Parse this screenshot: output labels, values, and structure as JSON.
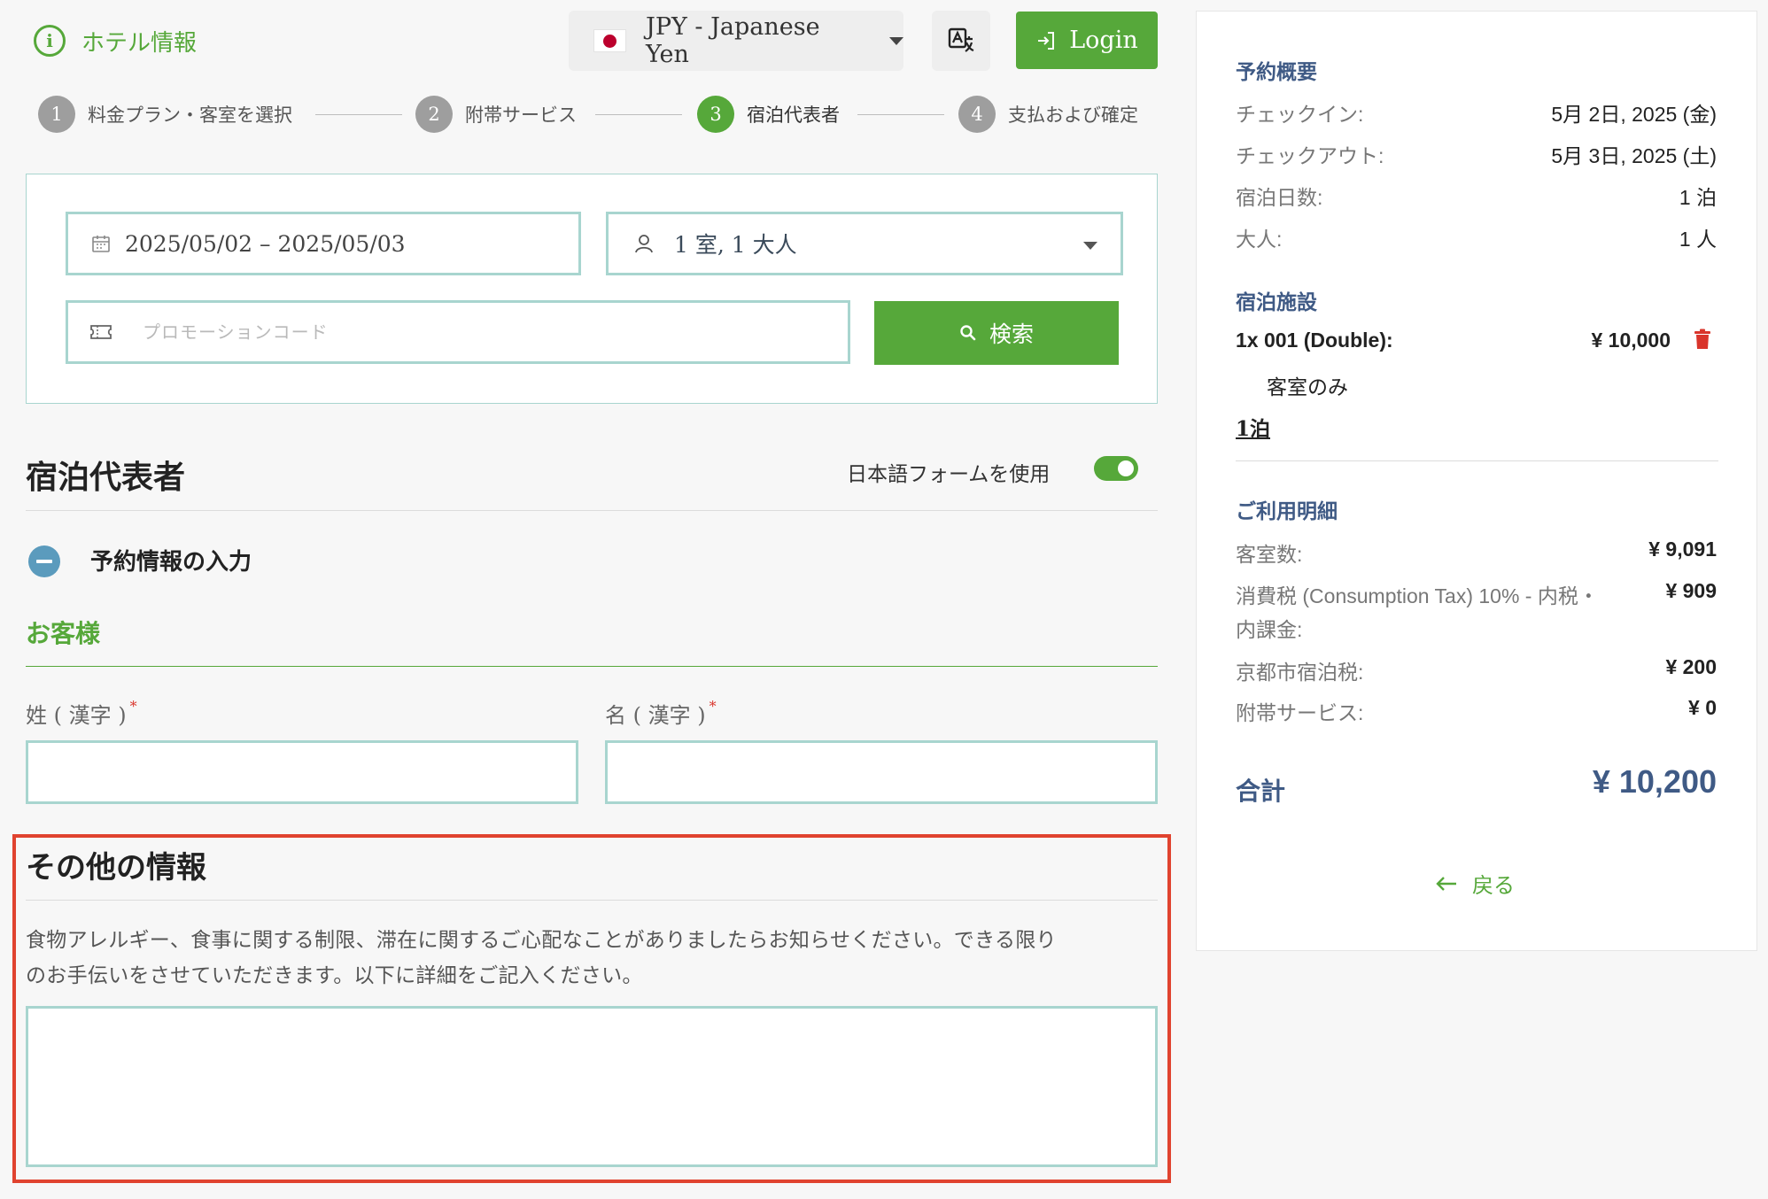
{
  "header": {
    "hotel_info_label": "ホテル情報",
    "currency_label": "JPY - Japanese Yen",
    "login_label": "Login"
  },
  "steps": [
    {
      "num": "1",
      "label": "料金プラン・客室を選択",
      "state": "done"
    },
    {
      "num": "2",
      "label": "附帯サービス",
      "state": "done"
    },
    {
      "num": "3",
      "label": "宿泊代表者",
      "state": "active"
    },
    {
      "num": "4",
      "label": "支払および確定",
      "state": "todo"
    }
  ],
  "search": {
    "date_range": "2025/05/02 – 2025/05/03",
    "guests": "1 室, 1 大人",
    "promo_placeholder": "プロモーションコード",
    "search_label": "検索"
  },
  "guest_section": {
    "title": "宿泊代表者",
    "jp_form_label": "日本語フォームを使用",
    "jp_form_enabled": true,
    "reservation_title": "予約情報の入力",
    "customer_label": "お客様",
    "last_name_label": "姓 ( 漢字 )",
    "first_name_label": "名 ( 漢字 )",
    "required_mark": "*",
    "last_name_value": "",
    "first_name_value": ""
  },
  "other_info": {
    "title": "その他の情報",
    "line1": "食物アレルギー、食事に関する制限、滞在に関するご心配なことがありましたらお知らせください。できる限り",
    "line2": "のお手伝いをさせていただきます。以下に詳細をご記入ください。",
    "value": ""
  },
  "summary": {
    "title": "予約概要",
    "checkin_label": "チェックイン:",
    "checkin_value": "5月 2日, 2025 (金)",
    "checkout_label": "チェックアウト:",
    "checkout_value": "5月 3日, 2025 (土)",
    "nights_label": "宿泊日数:",
    "nights_value": "1 泊",
    "adults_label": "大人:",
    "adults_value": "1 人",
    "property_title": "宿泊施設",
    "room_label": "1x 001 (Double):",
    "room_price": "¥ 10,000",
    "room_plan": "客室のみ",
    "room_nights": "1泊",
    "details_title": "ご利用明細",
    "rooms_label": "客室数:",
    "rooms_value": "¥ 9,091",
    "tax_label_1": "消費税 (Consumption Tax) 10% - 内税・",
    "tax_label_2": "内課金:",
    "tax_value": "¥ 909",
    "city_tax_label": "京都市宿泊税:",
    "city_tax_value": "¥ 200",
    "services_label": "附帯サービス:",
    "services_value": "¥ 0",
    "total_label": "合計",
    "total_value": "¥ 10,200",
    "back_label": "戻る"
  },
  "colors": {
    "brand_green": "#56a83a",
    "field_border": "#a8d5cf",
    "heading_blue": "#3f5a85",
    "highlight_red": "#e0432f",
    "trash_red": "#d9342b"
  }
}
